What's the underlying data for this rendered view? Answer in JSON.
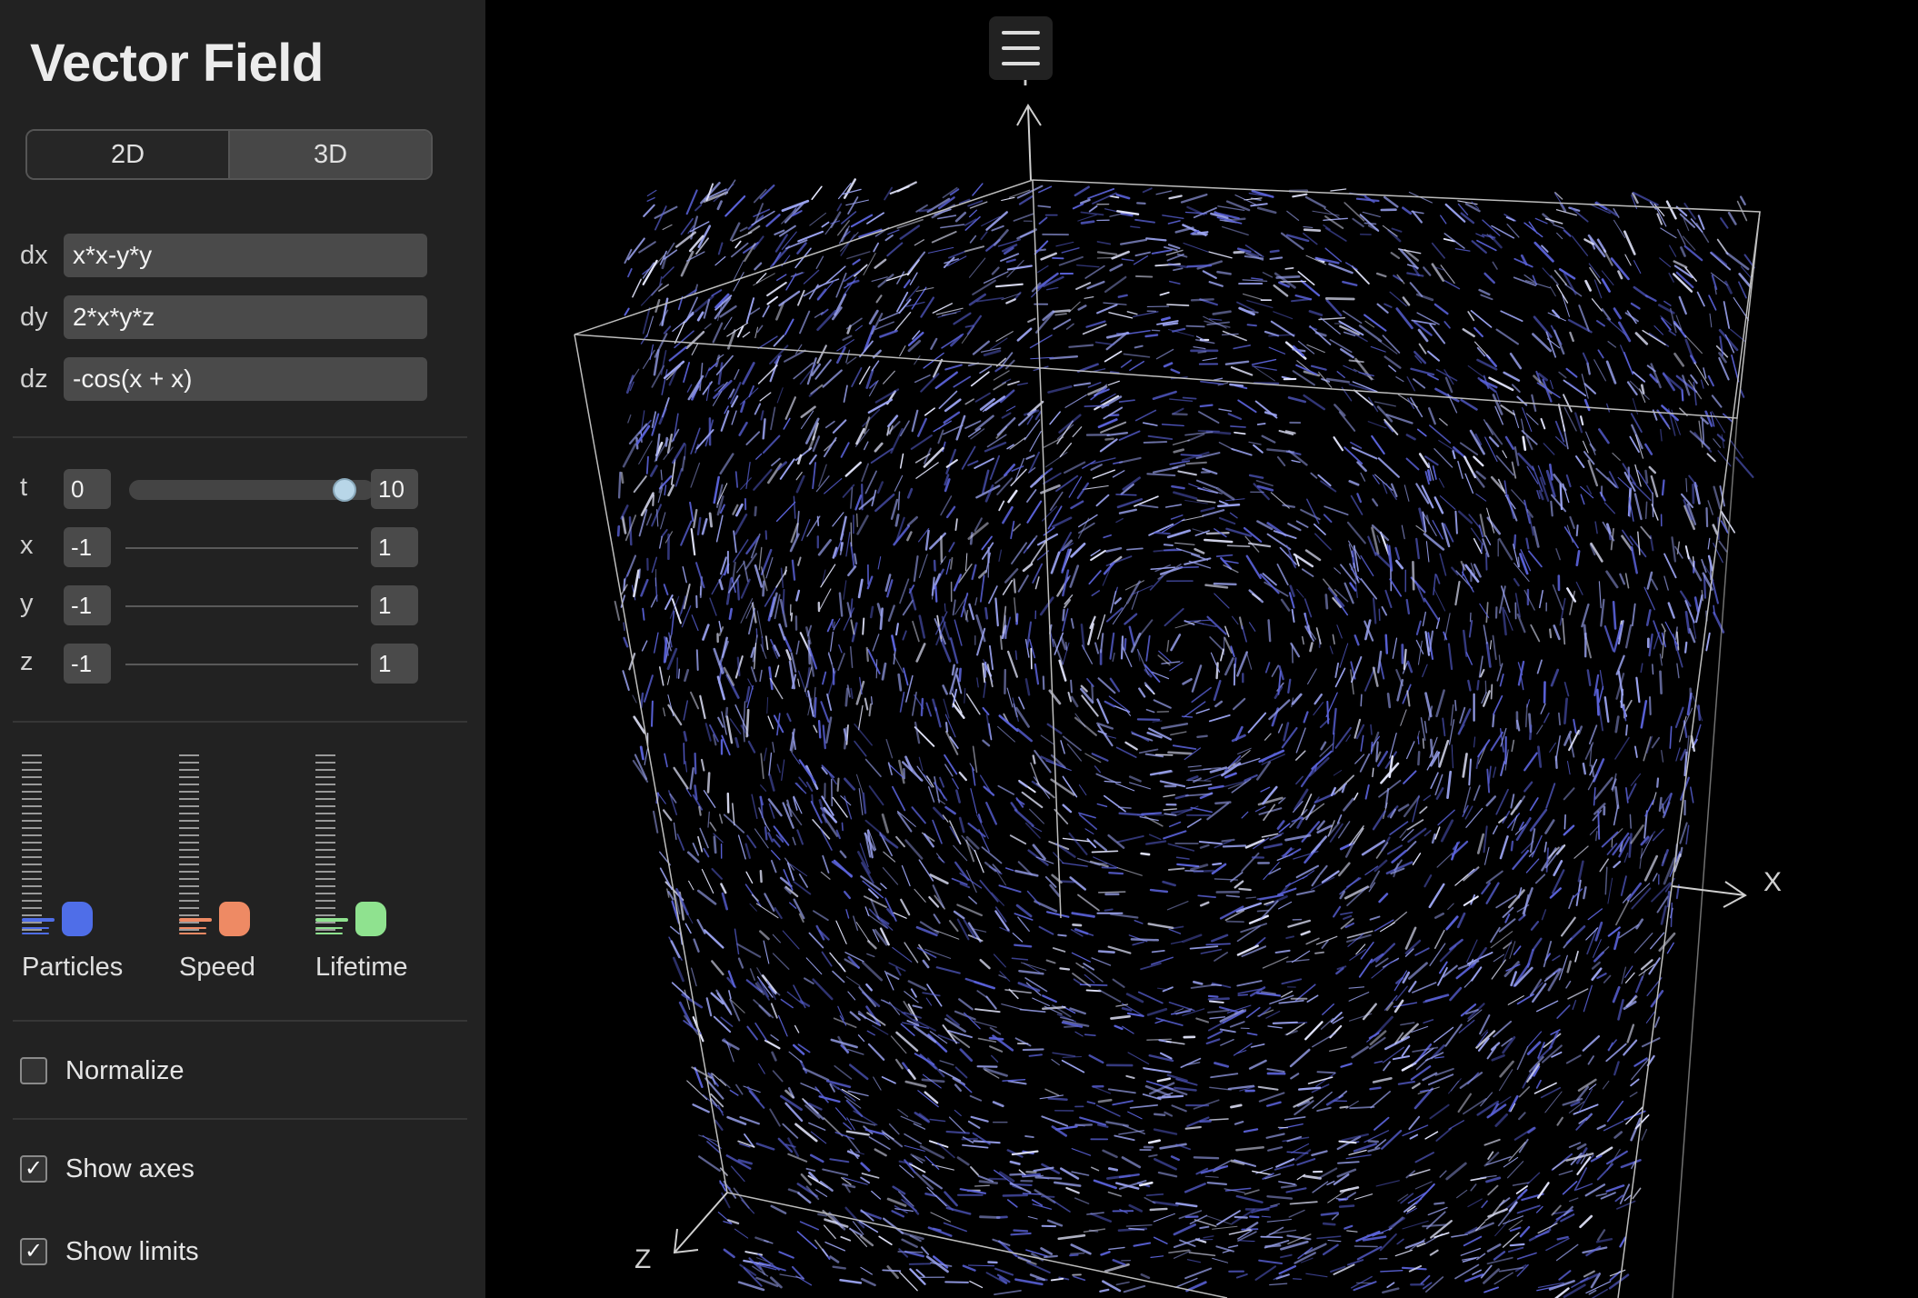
{
  "app": {
    "title": "Vector Field"
  },
  "mode": {
    "options": [
      "2D",
      "3D"
    ],
    "selected": "3D"
  },
  "expressions": [
    {
      "label": "dx",
      "value": "x*x-y*y"
    },
    {
      "label": "dy",
      "value": "2*x*y*z"
    },
    {
      "label": "dz",
      "value": "-cos(x + x)"
    }
  ],
  "ranges": {
    "t": {
      "label": "t",
      "min": "0",
      "max": "10",
      "value_fraction": 0.92
    },
    "x": {
      "label": "x",
      "min": "-1",
      "max": "1"
    },
    "y": {
      "label": "y",
      "min": "-1",
      "max": "1"
    },
    "z": {
      "label": "z",
      "min": "-1",
      "max": "1"
    }
  },
  "gauges": [
    {
      "label": "Particles",
      "color": "#4f6ee8",
      "level": 0.1
    },
    {
      "label": "Speed",
      "color": "#ee8a64",
      "level": 0.1
    },
    {
      "label": "Lifetime",
      "color": "#8fe28f",
      "level": 0.1
    }
  ],
  "options": [
    {
      "label": "Normalize",
      "checked": false
    },
    {
      "label": "Show axes",
      "checked": true
    },
    {
      "label": "Show limits",
      "checked": true
    }
  ],
  "axes": {
    "x": "X",
    "y": "Y",
    "z": "Z"
  },
  "icons": {
    "menu": "hamburger-menu-icon",
    "check": "checkmark-icon"
  },
  "colors": {
    "particles": "#7d86e8",
    "particles_highlight": "#e6e8ff",
    "background": "#000000"
  }
}
